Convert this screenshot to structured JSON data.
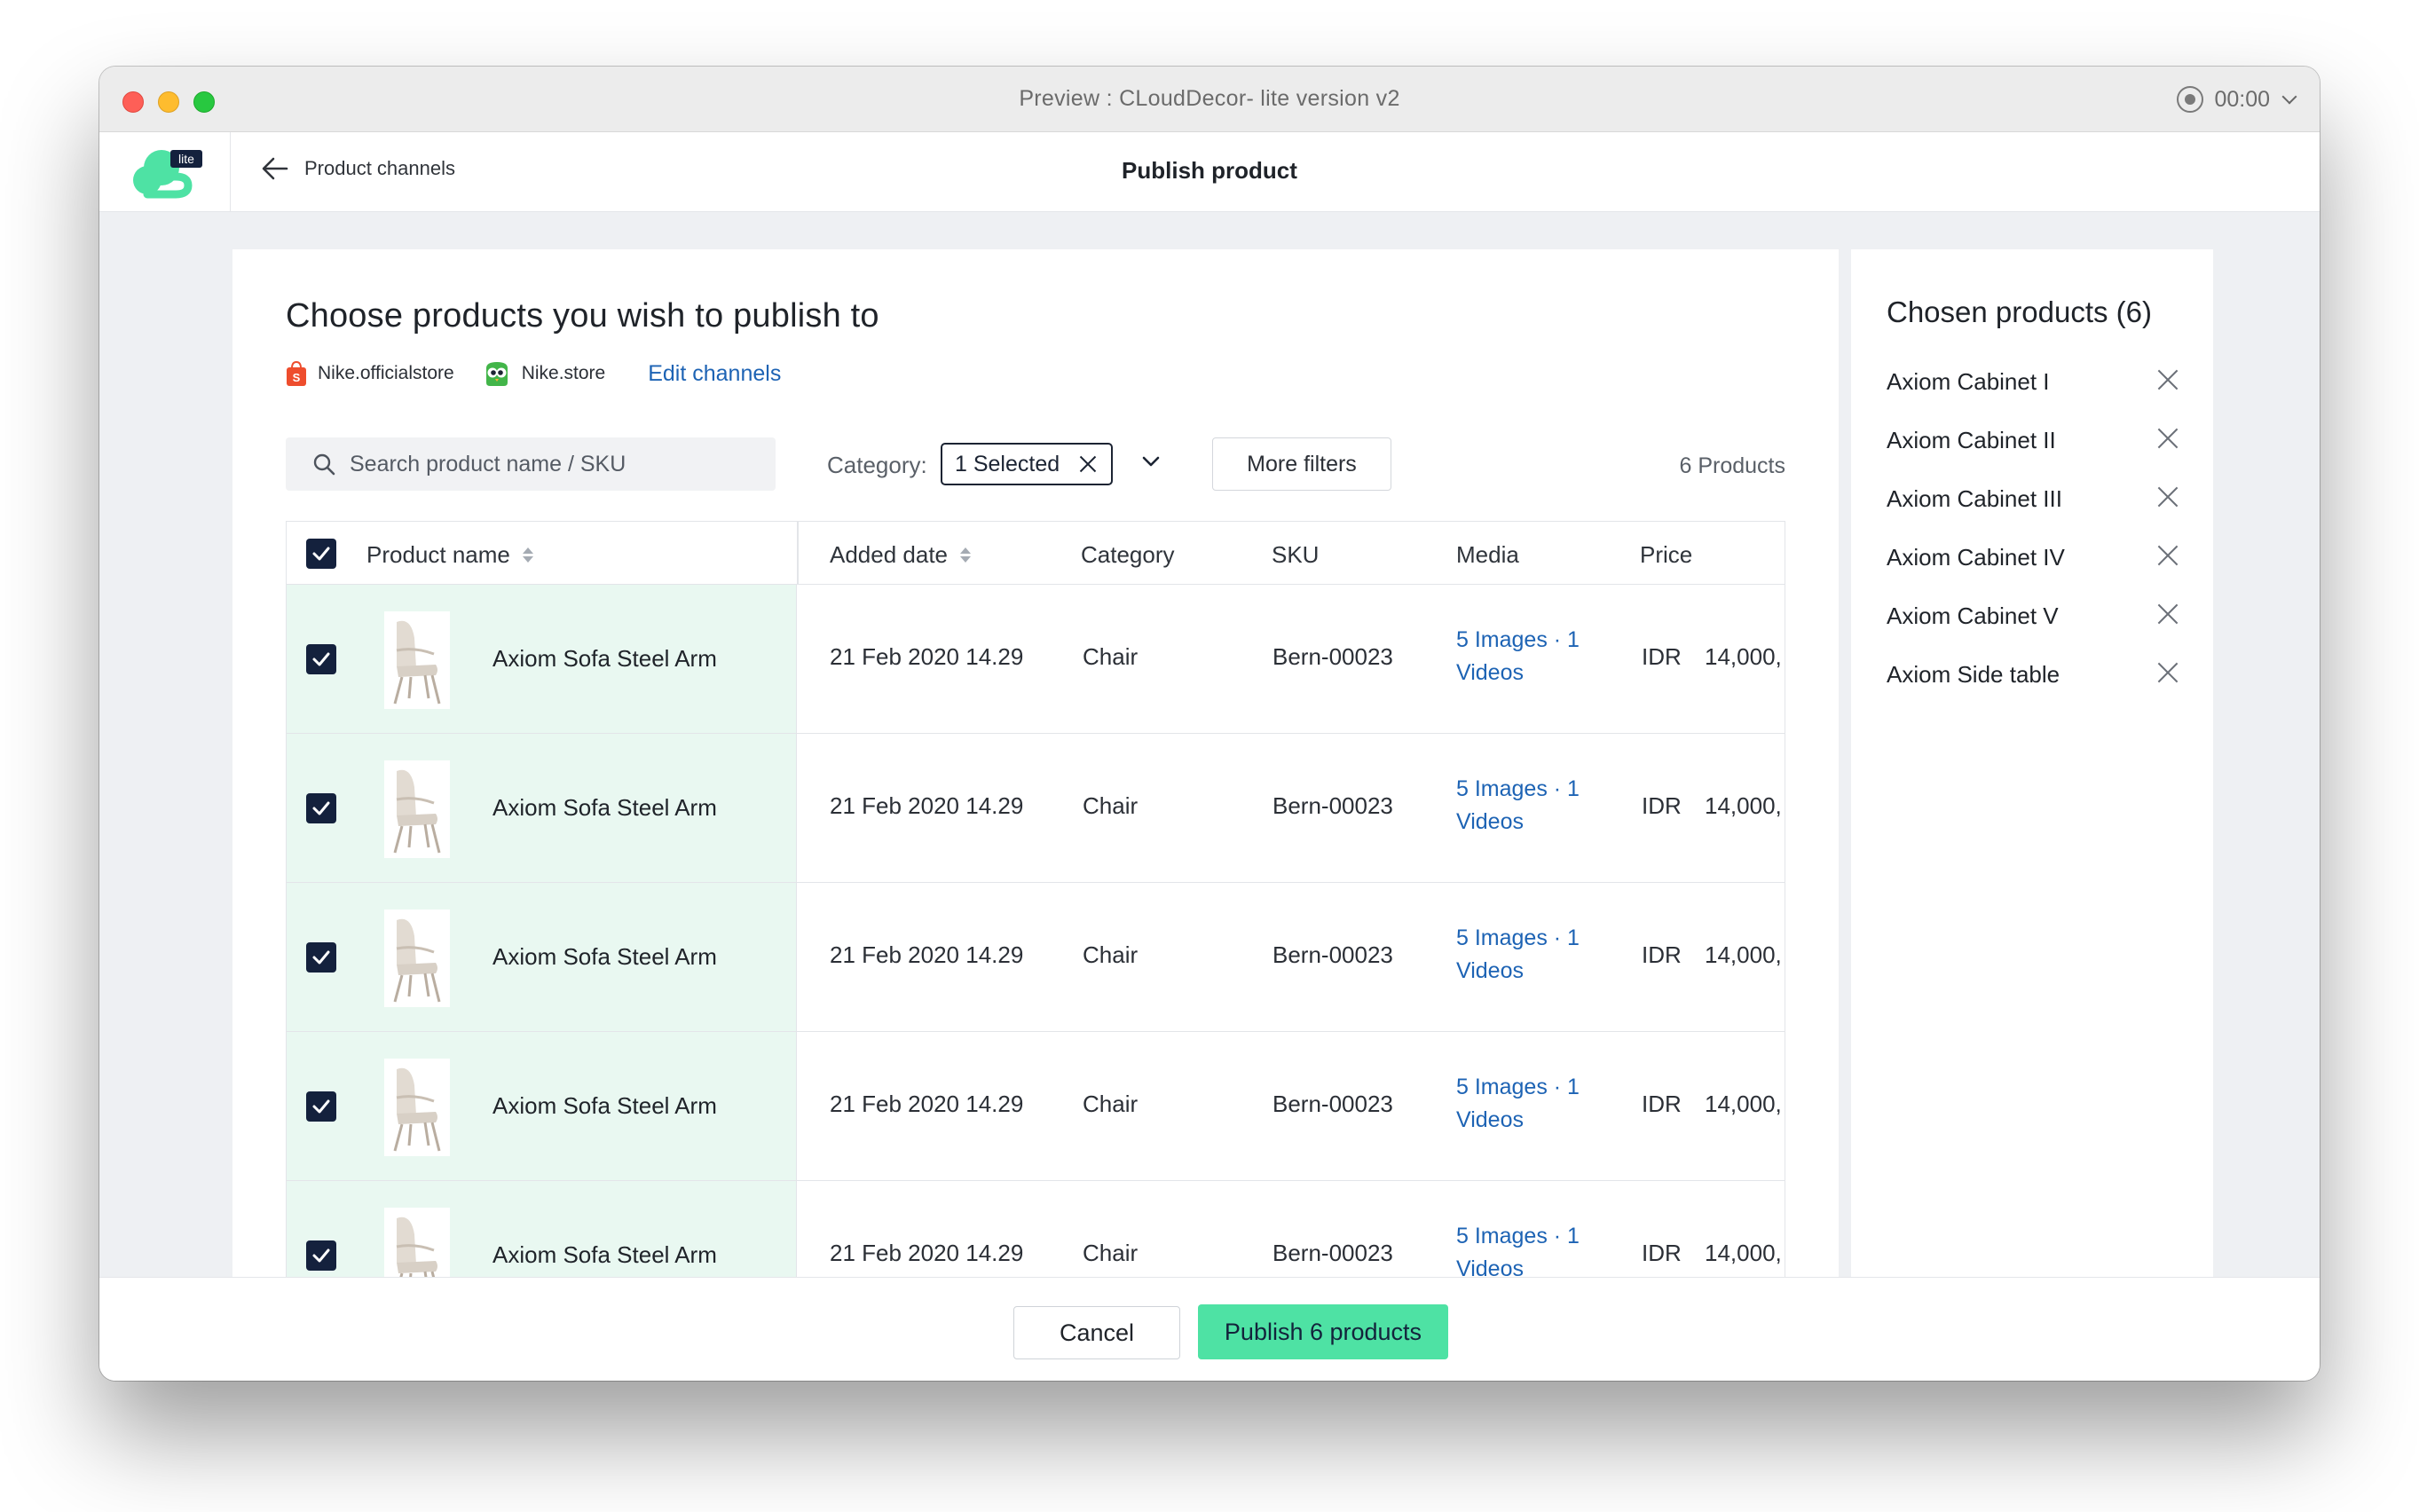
{
  "window": {
    "title": "Preview : CLoudDecor- lite version v2",
    "timer": "00:00"
  },
  "appbar": {
    "logo_badge": "lite",
    "back_label": "Product channels",
    "page_title": "Publish product"
  },
  "main": {
    "heading": "Choose products you wish to publish to",
    "channels": [
      {
        "name": "Nike.officialstore",
        "icon": "shopee-bag-icon"
      },
      {
        "name": "Nike.store",
        "icon": "tokopedia-owl-icon"
      }
    ],
    "edit_channels": "Edit channels",
    "search_placeholder": "Search product name / SKU",
    "category_label": "Category:",
    "category_chip": "1 Selected",
    "more_filters": "More filters",
    "product_count": "6 Products",
    "columns": {
      "name": "Product name",
      "added": "Added date",
      "category": "Category",
      "sku": "SKU",
      "media": "Media",
      "price": "Price"
    },
    "rows": [
      {
        "name": "Axiom Sofa Steel Arm",
        "added": "21 Feb 2020 14.29",
        "category": "Chair",
        "sku": "Bern-00023",
        "media": "5 Images · 1 Videos",
        "currency": "IDR",
        "price": "14,000,",
        "checked": true
      },
      {
        "name": "Axiom Sofa Steel Arm",
        "added": "21 Feb 2020 14.29",
        "category": "Chair",
        "sku": "Bern-00023",
        "media": "5 Images · 1 Videos",
        "currency": "IDR",
        "price": "14,000,",
        "checked": true
      },
      {
        "name": "Axiom Sofa Steel Arm",
        "added": "21 Feb 2020 14.29",
        "category": "Chair",
        "sku": "Bern-00023",
        "media": "5 Images · 1 Videos",
        "currency": "IDR",
        "price": "14,000,",
        "checked": true
      },
      {
        "name": "Axiom Sofa Steel Arm",
        "added": "21 Feb 2020 14.29",
        "category": "Chair",
        "sku": "Bern-00023",
        "media": "5 Images · 1 Videos",
        "currency": "IDR",
        "price": "14,000,",
        "checked": true
      },
      {
        "name": "Axiom Sofa Steel Arm",
        "added": "21 Feb 2020 14.29",
        "category": "Chair",
        "sku": "Bern-00023",
        "media": "5 Images · 1 Videos",
        "currency": "IDR",
        "price": "14,000,",
        "checked": true
      }
    ]
  },
  "side": {
    "title": "Chosen products (6)",
    "items": [
      "Axiom Cabinet I",
      "Axiom Cabinet II",
      "Axiom Cabinet III",
      "Axiom Cabinet IV",
      "Axiom Cabinet V",
      "Axiom Side table"
    ]
  },
  "footer": {
    "cancel": "Cancel",
    "publish": "Publish 6 products"
  },
  "colors": {
    "accent": "#4ee2a4",
    "link": "#1d63b4",
    "checkbox": "#14213d",
    "row_highlight": "#e9f8f1"
  }
}
